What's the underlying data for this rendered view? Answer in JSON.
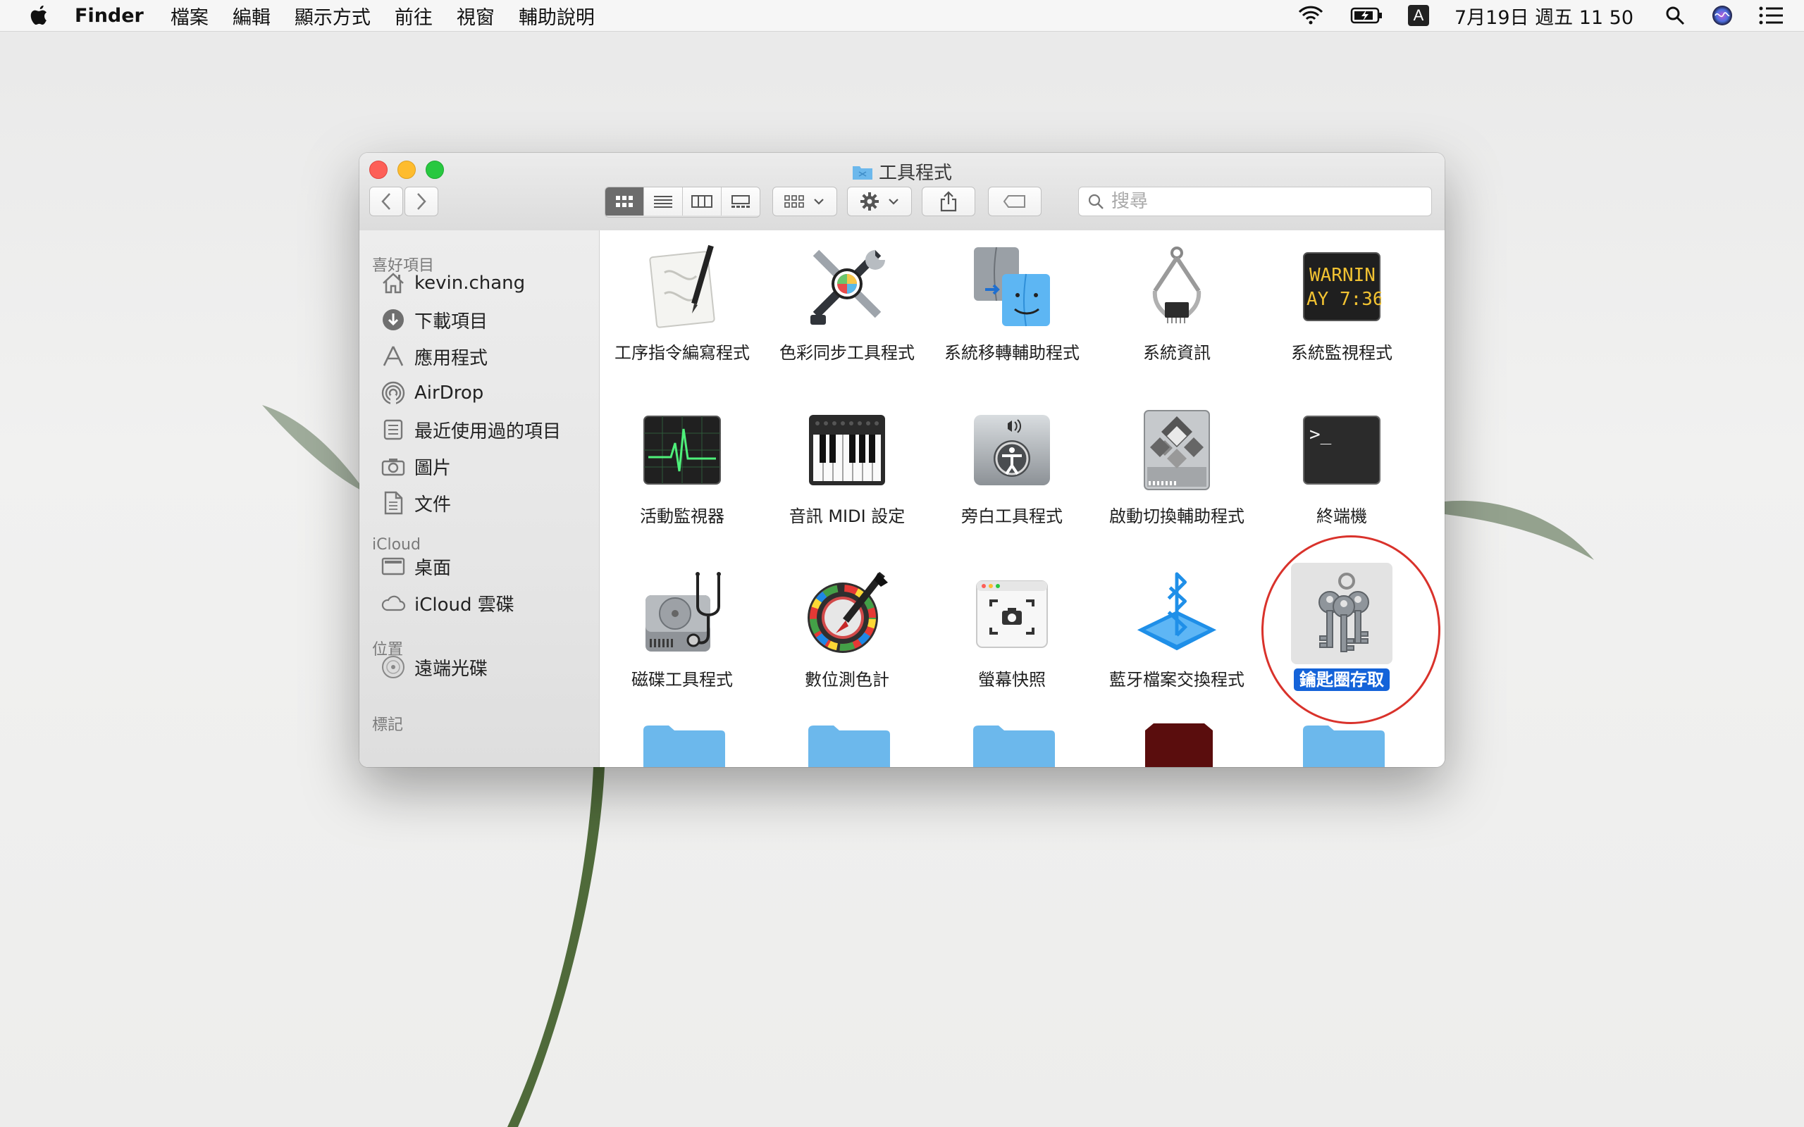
{
  "menubar": {
    "app": "Finder",
    "items": [
      "檔案",
      "編輯",
      "顯示方式",
      "前往",
      "視窗",
      "輔助說明"
    ],
    "input_method": "A",
    "clock": "7月19日 週五  11 50"
  },
  "window": {
    "title": "工具程式",
    "search_placeholder": "搜尋"
  },
  "sidebar": {
    "sections": [
      {
        "header": "喜好項目",
        "items": [
          "kevin.chang",
          "下載項目",
          "應用程式",
          "AirDrop",
          "最近使用過的項目",
          "圖片",
          "文件"
        ]
      },
      {
        "header": "iCloud",
        "items": [
          "桌面",
          "iCloud 雲碟"
        ]
      },
      {
        "header": "位置",
        "items": [
          "遠端光碟"
        ]
      },
      {
        "header": "標記",
        "items": []
      }
    ]
  },
  "apps": [
    {
      "label": "工序指令編寫程式",
      "icon": "script-editor-icon"
    },
    {
      "label": "色彩同步工具程式",
      "icon": "colorsync-icon"
    },
    {
      "label": "系統移轉輔助程式",
      "icon": "migration-assistant-icon"
    },
    {
      "label": "系統資訊",
      "icon": "system-information-icon"
    },
    {
      "label": "系統監視程式",
      "icon": "console-icon",
      "icon_text": [
        "WARNIN",
        "AY 7:36"
      ]
    },
    {
      "label": "活動監視器",
      "icon": "activity-monitor-icon"
    },
    {
      "label": "音訊 MIDI 設定",
      "icon": "audio-midi-icon"
    },
    {
      "label": "旁白工具程式",
      "icon": "voiceover-utility-icon"
    },
    {
      "label": "啟動切換輔助程式",
      "icon": "boot-camp-icon"
    },
    {
      "label": "終端機",
      "icon": "terminal-icon",
      "icon_text": [
        ">_"
      ]
    },
    {
      "label": "磁碟工具程式",
      "icon": "disk-utility-icon"
    },
    {
      "label": "數位測色計",
      "icon": "digital-color-meter-icon"
    },
    {
      "label": "螢幕快照",
      "icon": "screenshot-icon"
    },
    {
      "label": "藍牙檔案交換程式",
      "icon": "bluetooth-file-exchange-icon"
    },
    {
      "label": "鑰匙圈存取",
      "icon": "keychain-access-icon",
      "selected": true
    }
  ],
  "colors": {
    "selection": "#1463d9",
    "annotation_circle": "#d9322b",
    "folder": "#6cb8ec"
  }
}
